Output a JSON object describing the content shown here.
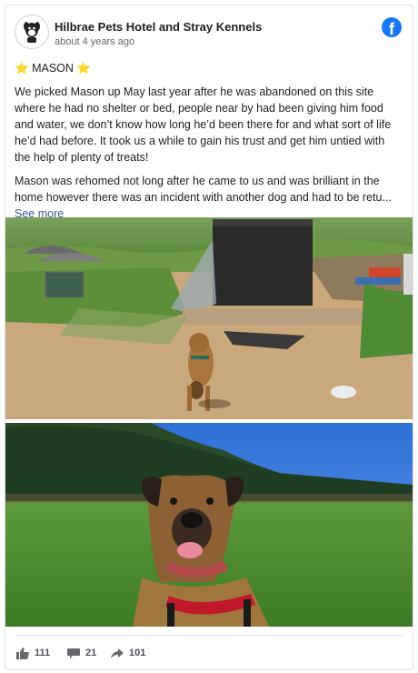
{
  "post": {
    "page_name": "Hilbrae Pets Hotel and Stray Kennels",
    "time": "about 4 years ago",
    "title_prefix": "⭐",
    "title": "MASON",
    "title_suffix": "⭐",
    "paragraph1": "We picked Mason up May last year after he was abandoned on this site where he had no shelter or bed, people near by had been giving him food and water, we don’t know how long he’d been there for and what sort of life he’d had before. It took us a while to gain his trust and get him untied with the help of plenty of treats!",
    "paragraph2": "Mason was rehomed not long after he came to us and was brilliant in the home however there was an incident with another dog and had to be retu...",
    "see_more": "See more"
  },
  "stats": {
    "likes": "111",
    "comments": "21",
    "shares": "101"
  },
  "icons": {
    "brand": "facebook-icon",
    "like": "thumbs-up-icon",
    "comment": "comment-bubble-icon",
    "share": "share-arrow-icon"
  },
  "colors": {
    "brand": "#1877f2",
    "link": "#385898",
    "star": "#f7b500"
  }
}
